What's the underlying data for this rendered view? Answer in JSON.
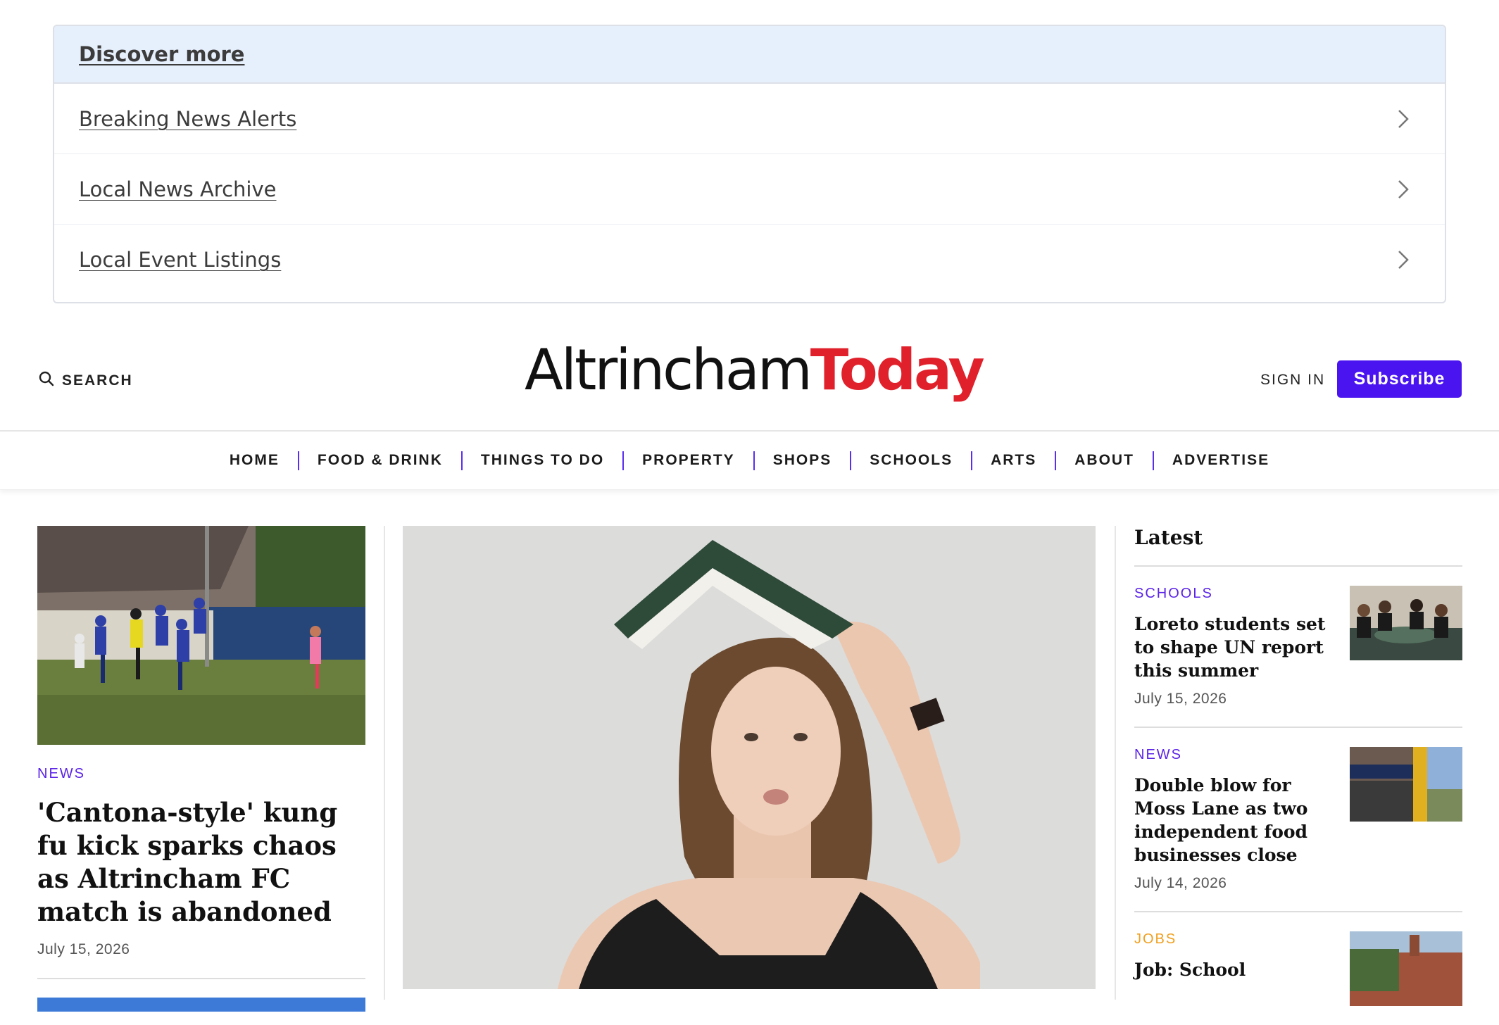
{
  "discover": {
    "title": "Discover more",
    "items": [
      {
        "label": "Breaking News Alerts"
      },
      {
        "label": "Local News Archive"
      },
      {
        "label": "Local Event Listings"
      }
    ]
  },
  "masthead": {
    "search_label": "SEARCH",
    "logo_part1": "Altrincham",
    "logo_part2": "Today",
    "signin_label": "SIGN IN",
    "subscribe_label": "Subscribe"
  },
  "nav": {
    "items": [
      "HOME",
      "FOOD & DRINK",
      "THINGS TO DO",
      "PROPERTY",
      "SHOPS",
      "SCHOOLS",
      "ARTS",
      "ABOUT",
      "ADVERTISE"
    ]
  },
  "lead": {
    "category": "NEWS",
    "headline": "'Cantona-style' kung fu kick sparks chaos as Altrincham FC match is abandoned",
    "date": "July 15, 2026"
  },
  "latest": {
    "title": "Latest",
    "items": [
      {
        "category": "SCHOOLS",
        "headline": "Loreto students set to shape UN report this summer",
        "date": "July 15, 2026"
      },
      {
        "category": "NEWS",
        "headline": "Double blow for Moss Lane as two independent food businesses close",
        "date": "July 14, 2026"
      },
      {
        "category": "JOBS",
        "headline": "Job: School"
      }
    ]
  },
  "colors": {
    "accent": "#4a14f0",
    "brand_red": "#e0202b",
    "category_purple": "#5a22e6",
    "category_orange": "#f0a020"
  }
}
